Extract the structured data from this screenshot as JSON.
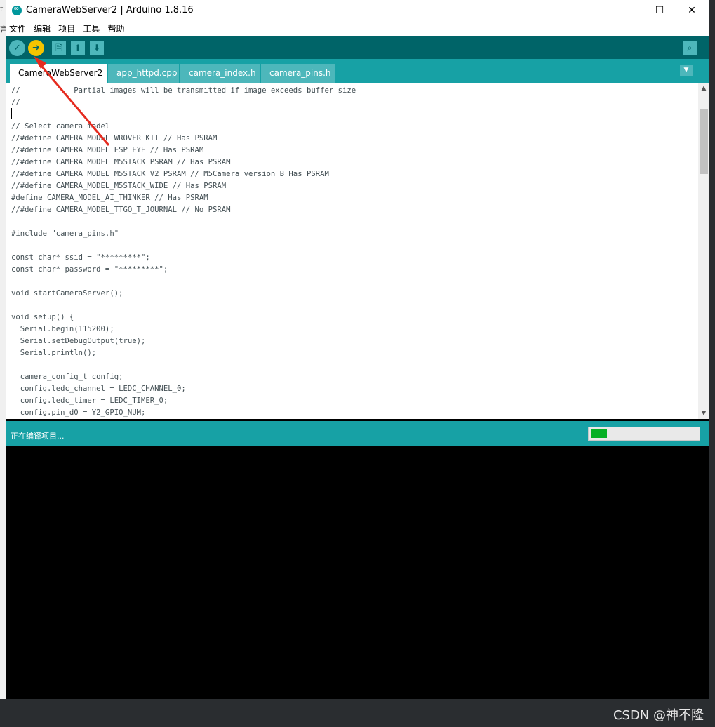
{
  "window": {
    "title": "CameraWebServer2 | Arduino 1.8.16",
    "controls": {
      "minimize": "—",
      "maximize": "☐",
      "close": "✕"
    }
  },
  "menu": [
    "文件",
    "编辑",
    "项目",
    "工具",
    "帮助"
  ],
  "toolbar": {
    "verify_icon": "✓",
    "upload_icon": "➜",
    "new_icon": "🗎",
    "open_icon": "⬆",
    "save_icon": "⬇",
    "serial_icon": "⌕"
  },
  "tabs": [
    "CameraWebServer2",
    "app_httpd.cpp",
    "camera_index.h",
    "camera_pins.h"
  ],
  "active_tab": 0,
  "code_lines": [
    "//            Partial images will be transmitted if image exceeds buffer size",
    "//",
    "",
    "// Select camera model",
    "//#define CAMERA_MODEL_WROVER_KIT // Has PSRAM",
    "//#define CAMERA_MODEL_ESP_EYE // Has PSRAM",
    "//#define CAMERA_MODEL_M5STACK_PSRAM // Has PSRAM",
    "//#define CAMERA_MODEL_M5STACK_V2_PSRAM // M5Camera version B Has PSRAM",
    "//#define CAMERA_MODEL_M5STACK_WIDE // Has PSRAM",
    "#define CAMERA_MODEL_AI_THINKER // Has PSRAM",
    "//#define CAMERA_MODEL_TTGO_T_JOURNAL // No PSRAM",
    "",
    "#include \"camera_pins.h\"",
    "",
    "const char* ssid = \"*********\";",
    "const char* password = \"*********\";",
    "",
    "void startCameraServer();",
    "",
    "void setup() {",
    "  Serial.begin(115200);",
    "  Serial.setDebugOutput(true);",
    "  Serial.println();",
    "",
    "  camera_config_t config;",
    "  config.ledc_channel = LEDC_CHANNEL_0;",
    "  config.ledc_timer = LEDC_TIMER_0;",
    "  config.pin_d0 = Y2_GPIO_NUM;"
  ],
  "status": {
    "message": "正在编译项目...",
    "progress": 0.15
  },
  "scrollbar": {
    "up": "▲",
    "down": "▼"
  },
  "tab_menu_icon": "▼",
  "watermark": "CSDN @神不隆",
  "colors": {
    "teal_dark": "#006468",
    "teal": "#17a1a5",
    "teal_light": "#4db7bb",
    "upload_button": "#f5c400",
    "progress_fill": "#06b025",
    "arrow": "#e52b1f"
  }
}
